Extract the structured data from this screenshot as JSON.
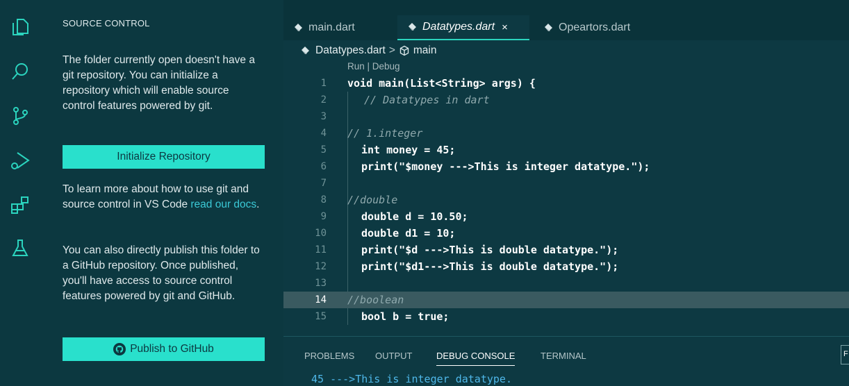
{
  "sidebar": {
    "title": "SOURCE CONTROL",
    "intro": "The folder currently open doesn't have a git repository. You can initialize a repository which will enable source control features powered by git.",
    "init_button": "Initialize Repository",
    "learn_prefix": "To learn more about how to use git and source control in VS Code ",
    "learn_link": "read our docs",
    "learn_suffix": ".",
    "publish_text": "You can also directly publish this folder to a GitHub repository. Once published, you'll have access to source control features powered by git and GitHub.",
    "publish_button": "Publish to GitHub"
  },
  "activity_icons": [
    "explorer-icon",
    "search-icon",
    "source-control-icon",
    "run-debug-icon",
    "extensions-icon",
    "testing-icon"
  ],
  "tabs": [
    {
      "label": "main.dart",
      "active": false
    },
    {
      "label": "Datatypes.dart",
      "active": true,
      "close": "×"
    },
    {
      "label": "Opeartors.dart",
      "active": false
    }
  ],
  "breadcrumb": {
    "file": "Datatypes.dart",
    "separator": ">",
    "symbol": "main"
  },
  "codelens": "Run | Debug",
  "code_lines": [
    {
      "n": "1",
      "text": "void main(List<String> args) {"
    },
    {
      "n": "2",
      "text": "// Datatypes in dart"
    },
    {
      "n": "3",
      "text": ""
    },
    {
      "n": "4",
      "text": "// 1.integer"
    },
    {
      "n": "5",
      "text": "int money = 45;"
    },
    {
      "n": "6",
      "text": "print(\"$money --->This is integer datatype.\");"
    },
    {
      "n": "7",
      "text": ""
    },
    {
      "n": "8",
      "text": "//double"
    },
    {
      "n": "9",
      "text": "double d = 10.50;"
    },
    {
      "n": "10",
      "text": "double d1 = 10;"
    },
    {
      "n": "11",
      "text": "print(\"$d --->This is double datatype.\");"
    },
    {
      "n": "12",
      "text": "print(\"$d1--->This is double datatype.\");"
    },
    {
      "n": "13",
      "text": ""
    },
    {
      "n": "14",
      "text": "//boolean"
    },
    {
      "n": "15",
      "text": "bool b = true;"
    }
  ],
  "panel": {
    "tabs": [
      "PROBLEMS",
      "OUTPUT",
      "DEBUG CONSOLE",
      "TERMINAL"
    ],
    "active_tab": "DEBUG CONSOLE",
    "console_output": "45 --->This is integer datatype.",
    "edge_label": "F"
  },
  "colors": {
    "accent": "#29e0cc",
    "background": "#0c3840",
    "keyword": "#40b8e8",
    "comment": "#8fa9ad"
  }
}
